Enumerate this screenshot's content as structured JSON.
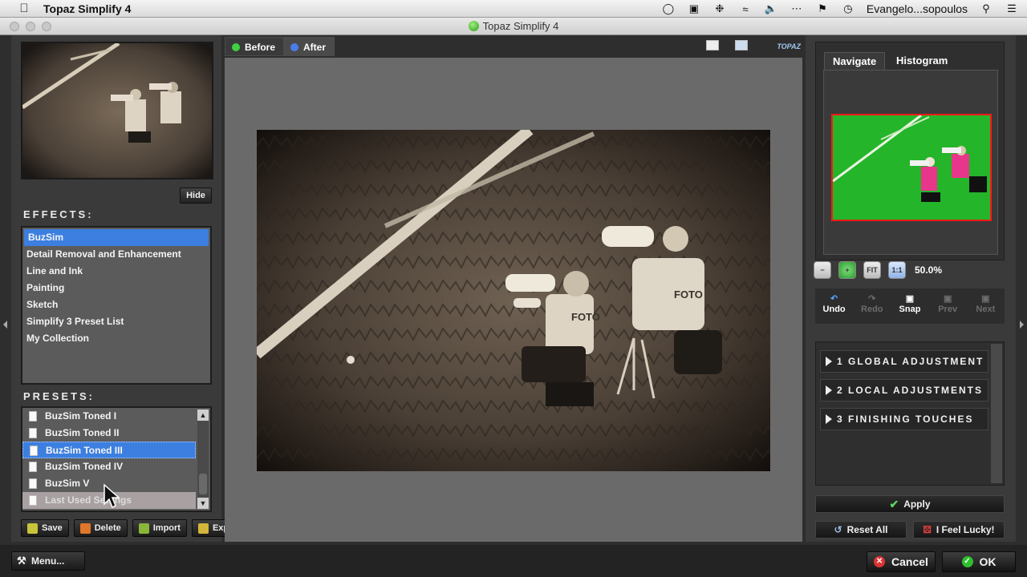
{
  "menubar": {
    "app_name": "Topaz Simplify 4",
    "user": "Evangelo...sopoulos"
  },
  "window": {
    "title": "Topaz Simplify 4"
  },
  "left": {
    "hide_label": "Hide",
    "effects_title": "EFFECTS:",
    "effects": [
      {
        "label": "BuzSim",
        "selected": true
      },
      {
        "label": "Detail Removal and Enhancement",
        "selected": false
      },
      {
        "label": "Line and Ink",
        "selected": false
      },
      {
        "label": "Painting",
        "selected": false
      },
      {
        "label": "Sketch",
        "selected": false
      },
      {
        "label": "Simplify 3 Preset List",
        "selected": false
      },
      {
        "label": "My Collection",
        "selected": false
      }
    ],
    "presets_title": "PRESETS:",
    "presets": [
      {
        "label": "BuzSim Toned I"
      },
      {
        "label": "BuzSim Toned II"
      },
      {
        "label": "BuzSim Toned III"
      },
      {
        "label": "BuzSim Toned IV"
      },
      {
        "label": "BuzSim V"
      },
      {
        "label": "Last Used Settings"
      }
    ],
    "buttons": {
      "save": "Save",
      "delete": "Delete",
      "import": "Import",
      "export": "Export"
    }
  },
  "center": {
    "tab_before": "Before",
    "tab_after": "After",
    "logo": "TOPAZ"
  },
  "right": {
    "tab_navigate": "Navigate",
    "tab_histogram": "Histogram",
    "zoom_level": "50.0%",
    "zoom_fit": "FIT",
    "zoom_1to1": "1:1",
    "history": {
      "undo": "Undo",
      "redo": "Redo",
      "snap": "Snap",
      "prev": "Prev",
      "next": "Next"
    },
    "adjustments": [
      {
        "label": "1 GLOBAL ADJUSTMENT"
      },
      {
        "label": "2 LOCAL ADJUSTMENTS"
      },
      {
        "label": "3 FINISHING TOUCHES"
      }
    ],
    "apply": "Apply",
    "reset_all": "Reset All",
    "feel_lucky": "I Feel Lucky!"
  },
  "bottom": {
    "menu": "Menu...",
    "cancel": "Cancel",
    "ok": "OK"
  },
  "colors": {
    "selection_blue": "#3c7fe0",
    "ok_green": "#2fbf2f",
    "cancel_red": "#d33"
  }
}
